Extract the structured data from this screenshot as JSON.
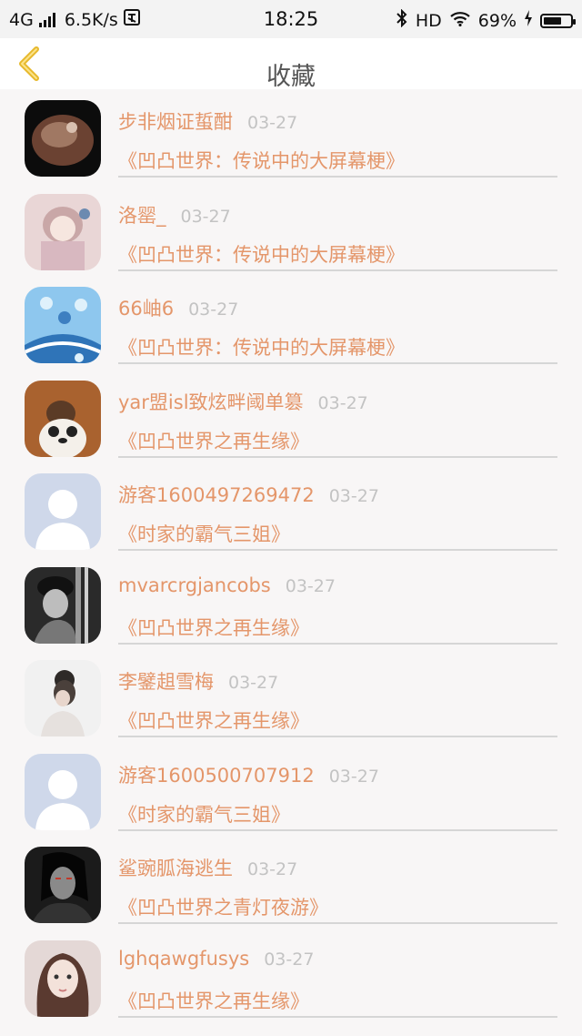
{
  "status": {
    "network": "4G",
    "speed": "6.5K/s",
    "time": "18:25",
    "hd": "HD",
    "battery": "69%",
    "battery_level": 0.69
  },
  "nav": {
    "title": "收藏"
  },
  "items": [
    {
      "name": "步非烟证蜇酣",
      "date": "03-27",
      "book": "《凹凸世界：传说中的大屏幕梗》"
    },
    {
      "name": "洛罂_",
      "date": "03-27",
      "book": "《凹凸世界：传说中的大屏幕梗》"
    },
    {
      "name": "66岫6",
      "date": "03-27",
      "book": "《凹凸世界：传说中的大屏幕梗》"
    },
    {
      "name": "yar盟isl致炫畔阈单篡",
      "date": "03-27",
      "book": "《凹凸世界之再生缘》"
    },
    {
      "name": "游客1600497269472",
      "date": "03-27",
      "book": "《时家的霸气三姐》"
    },
    {
      "name": "mvarcrgjancobs",
      "date": "03-27",
      "book": "《凹凸世界之再生缘》"
    },
    {
      "name": "李鐾趄雪梅",
      "date": "03-27",
      "book": "《凹凸世界之再生缘》"
    },
    {
      "name": "游客1600500707912",
      "date": "03-27",
      "book": "《时家的霸气三姐》"
    },
    {
      "name": "鲨豌胍海逃生",
      "date": "03-27",
      "book": "《凹凸世界之青灯夜游》"
    },
    {
      "name": "lghqawgfusys",
      "date": "03-27",
      "book": "《凹凸世界之再生缘》"
    }
  ]
}
